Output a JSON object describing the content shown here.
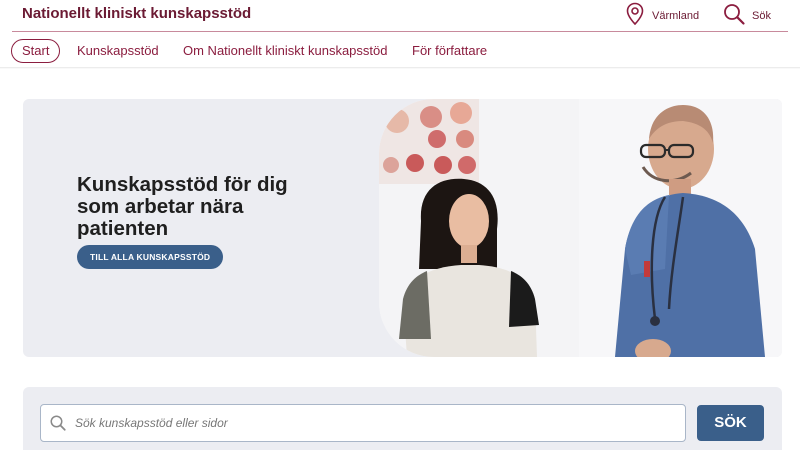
{
  "header": {
    "site_title": "Nationellt kliniskt kunskapsstöd",
    "region_label": "Värmland",
    "search_label": "Sök"
  },
  "nav": {
    "items": [
      {
        "label": "Start",
        "active": true
      },
      {
        "label": "Kunskapsstöd",
        "active": false
      },
      {
        "label": "Om Nationellt kliniskt kunskapsstöd",
        "active": false
      },
      {
        "label": "För författare",
        "active": false
      }
    ]
  },
  "hero": {
    "title": "Kunskapsstöd för dig som arbetar nära patienten",
    "button_label": "TILL ALLA KUNSKAPSSTÖD"
  },
  "search": {
    "placeholder": "Sök kunskapsstöd eller sidor",
    "value": "",
    "button_label": "SÖK"
  },
  "colors": {
    "brand": "#8b1d3f",
    "title": "#6b1a33",
    "button": "#3a5f8a",
    "panel_bg": "#ecedf2"
  }
}
